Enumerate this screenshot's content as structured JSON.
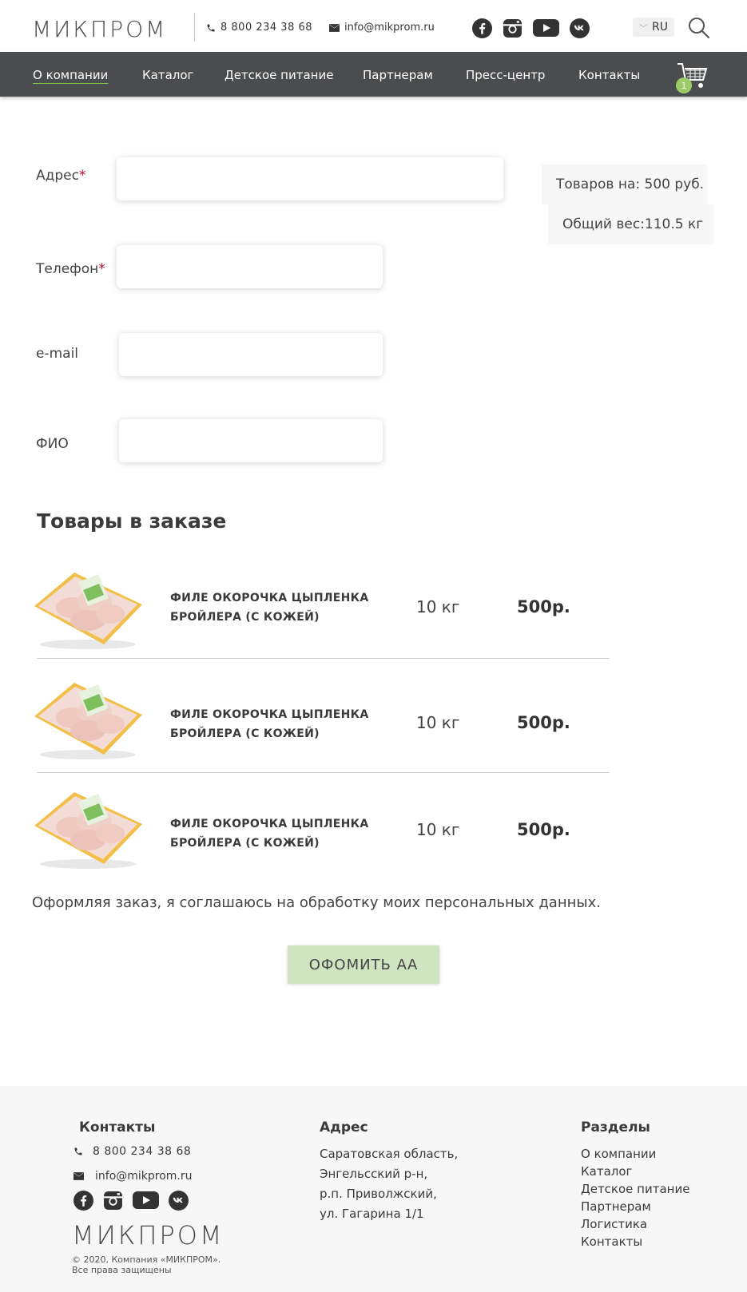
{
  "header": {
    "logo": "МИКПРОМ",
    "phone": "8 800 234 38 68",
    "email": "info@mikprom.ru",
    "lang": "RU",
    "socials": [
      "facebook-icon",
      "instagram-icon",
      "youtube-icon",
      "vk-icon"
    ]
  },
  "nav": {
    "items": [
      "О компании",
      "Каталог",
      "Детское питание",
      "Партнерам",
      "Пресс-центр",
      "Контакты"
    ],
    "cart_count": "1"
  },
  "form": {
    "address_label": "Адрес",
    "phone_label": "Телефон",
    "email_label": "e-mail",
    "name_label": "ФИО",
    "required_mark": "*",
    "address_value": "",
    "phone_value": "",
    "email_value": "",
    "name_value": ""
  },
  "summary": {
    "total": "Товаров на: 500 руб.",
    "weight": "Общий вес:110.5 кг"
  },
  "order": {
    "heading": "Товары в заказе",
    "items": [
      {
        "name_line1": "ФИЛЕ ОКОРОЧКА ЦЫПЛЕНКА",
        "name_line2": "БРОЙЛЕРА (С КОЖЕЙ)",
        "qty": "10 кг",
        "price": "500р."
      },
      {
        "name_line1": "ФИЛЕ ОКОРОЧКА ЦЫПЛЕНКА",
        "name_line2": "БРОЙЛЕРА (С КОЖЕЙ)",
        "qty": "10 кг",
        "price": "500р."
      },
      {
        "name_line1": "ФИЛЕ ОКОРОЧКА ЦЫПЛЕНКА",
        "name_line2": "БРОЙЛЕРА (С КОЖЕЙ)",
        "qty": "10 кг",
        "price": "500р."
      }
    ],
    "consent": "Оформляя заказ, я соглашаюсь на обработку моих персональных данных.",
    "submit": "ОФОМИТЬ АА"
  },
  "footer": {
    "contacts_heading": "Контакты",
    "phone": "8 800 234 38 68",
    "email": "info@mikprom.ru",
    "address_heading": "Адрес",
    "address_lines": [
      "Саратовская область,",
      "Энгельсский р-н,",
      "р.п. Приволжский,",
      "ул. Гагарина 1/1"
    ],
    "sections_heading": "Разделы",
    "sections": [
      "О компании",
      "Каталог",
      "Детское питание",
      "Партнерам",
      "Логистика",
      "Контакты"
    ],
    "logo": "МИКПРОМ",
    "copyright_line1": "© 2020, Компания «МИКПРОМ».",
    "copyright_line2": "Все права защищены"
  },
  "colors": {
    "nav_bg": "#4b4c4e",
    "accent_green": "#8bc34a",
    "button_bg": "#cfe4c0",
    "required": "#b2102f",
    "footer_bg": "#f7f7f7"
  }
}
